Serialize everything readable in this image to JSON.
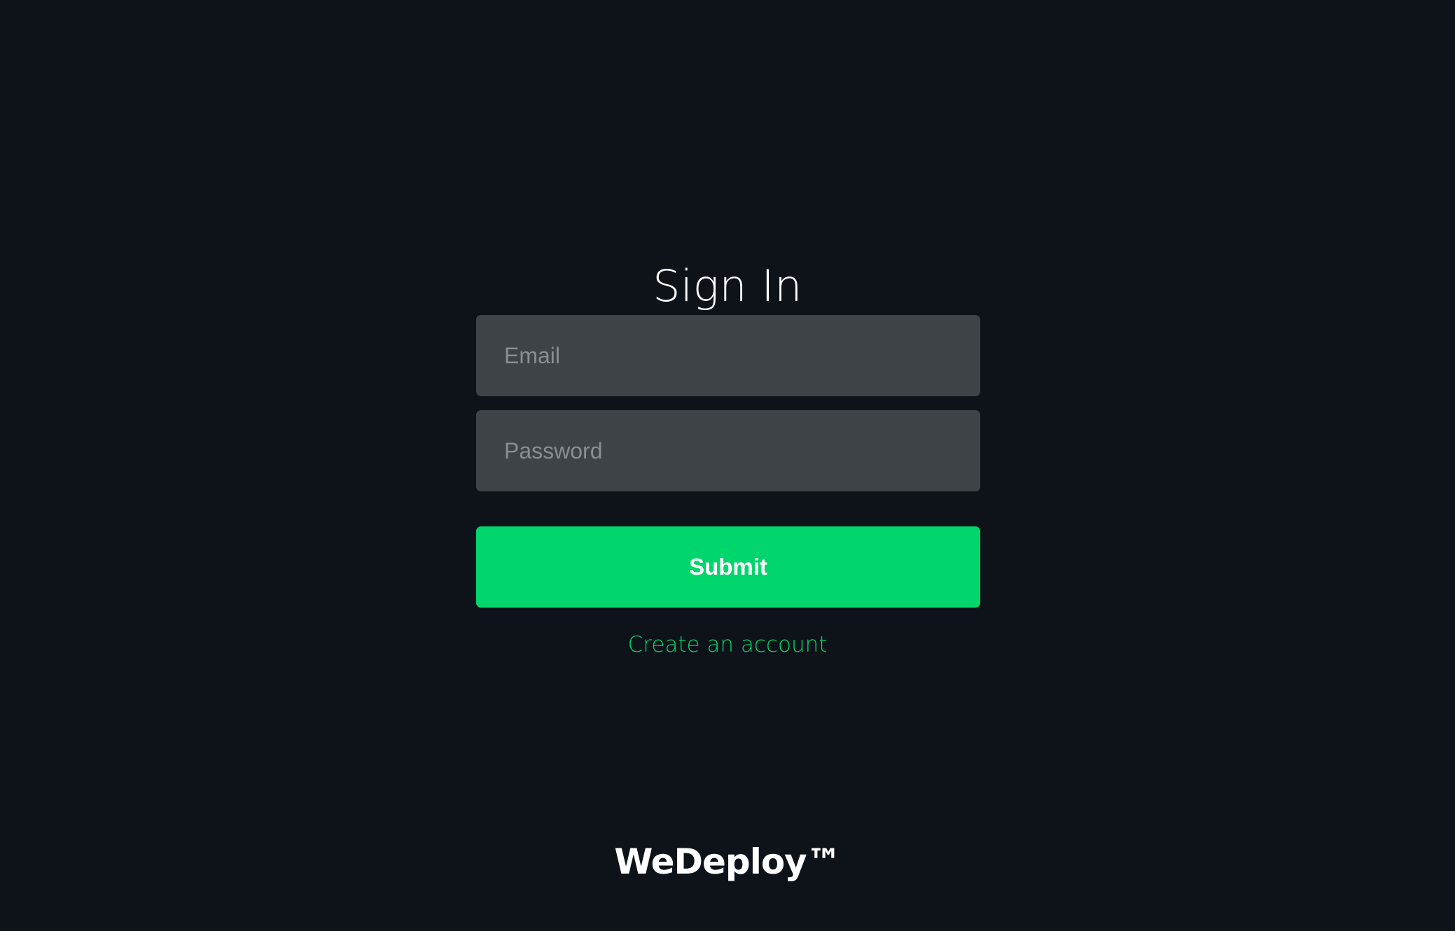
{
  "colors": {
    "background": "#0e131a",
    "field_background": "#3e4347",
    "accent": "#00d66b",
    "text": "#ffffff"
  },
  "signin": {
    "title": "Sign In",
    "email_placeholder": "Email",
    "password_placeholder": "Password",
    "submit_label": "Submit",
    "create_account_label": "Create an account"
  },
  "footer": {
    "logo_text": "WeDeploy™"
  }
}
